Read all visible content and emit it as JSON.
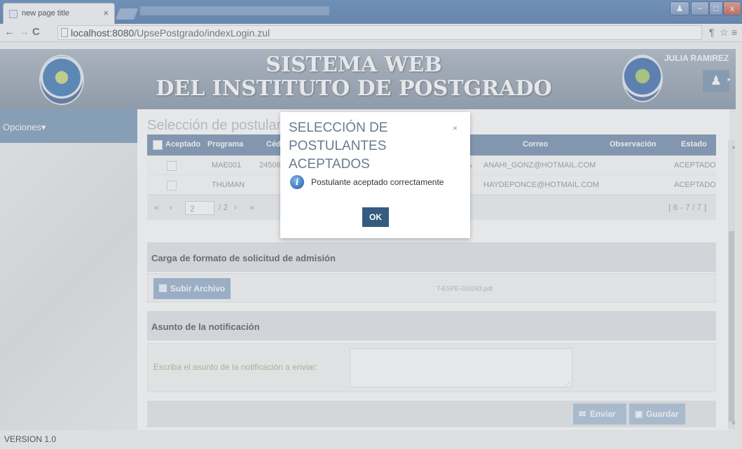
{
  "browser": {
    "tab_title": "new page title",
    "tab_close": "×",
    "url_host": "localhost:8080",
    "url_path": "/UpsePostgrado/indexLogin.zul",
    "window_buttons": [
      "−",
      "□",
      "x"
    ]
  },
  "header": {
    "title_line1": "SISTEMA WEB",
    "title_line2": "DEL INSTITUTO DE POSTGRADO",
    "user_name": "JULIA RAMIREZ"
  },
  "sidebar": {
    "label": "Opciones",
    "caret": "▾"
  },
  "main": {
    "section_title": "Selección de postulantes aceptados",
    "columns": [
      "Aceptado",
      "Programa",
      "Céd",
      "Correo",
      "Observación",
      "Estado"
    ],
    "rows": [
      {
        "programa": "MAE001",
        "cedula": "24506",
        "extra": "A",
        "correo": "ANAHI_GONZ@HOTMAIL.COM",
        "estado": "ACEPTADO"
      },
      {
        "programa": "THUMAN",
        "cedula": "",
        "extra": "",
        "correo": "HAYDEPONCE@HOTMAIL.COM",
        "estado": "ACEPTADO"
      }
    ],
    "pager": {
      "first": "«",
      "prev": "‹",
      "page": "2",
      "total": "/ 2",
      "next": "›",
      "last": "»",
      "range": "[ 6 - 7 / 7 ]"
    },
    "carga_title": "Carga de formato de solicitud de admisión",
    "subir_label": "Subir Archivo",
    "file_name": "T-ESPE-033263.pdf",
    "asunto_title": "Asunto de la notificación",
    "asunto_label": "Escriba el asunto de la notificación a enviar:",
    "asunto_value": "",
    "enviar_label": "Enviar",
    "guardar_label": "Guardar"
  },
  "modal": {
    "title": "SELECCIÓN DE POSTULANTES ACEPTADOS",
    "close": "×",
    "message": "Postulante aceptado correctamente",
    "ok_label": "OK"
  },
  "footer": {
    "version": "VERSION 1.0"
  },
  "colors": {
    "header_bg": "#8d99aa",
    "sidebar_bg": "#6f8fb2",
    "grid_header": "#6784a6",
    "ok_button": "#365b80"
  }
}
